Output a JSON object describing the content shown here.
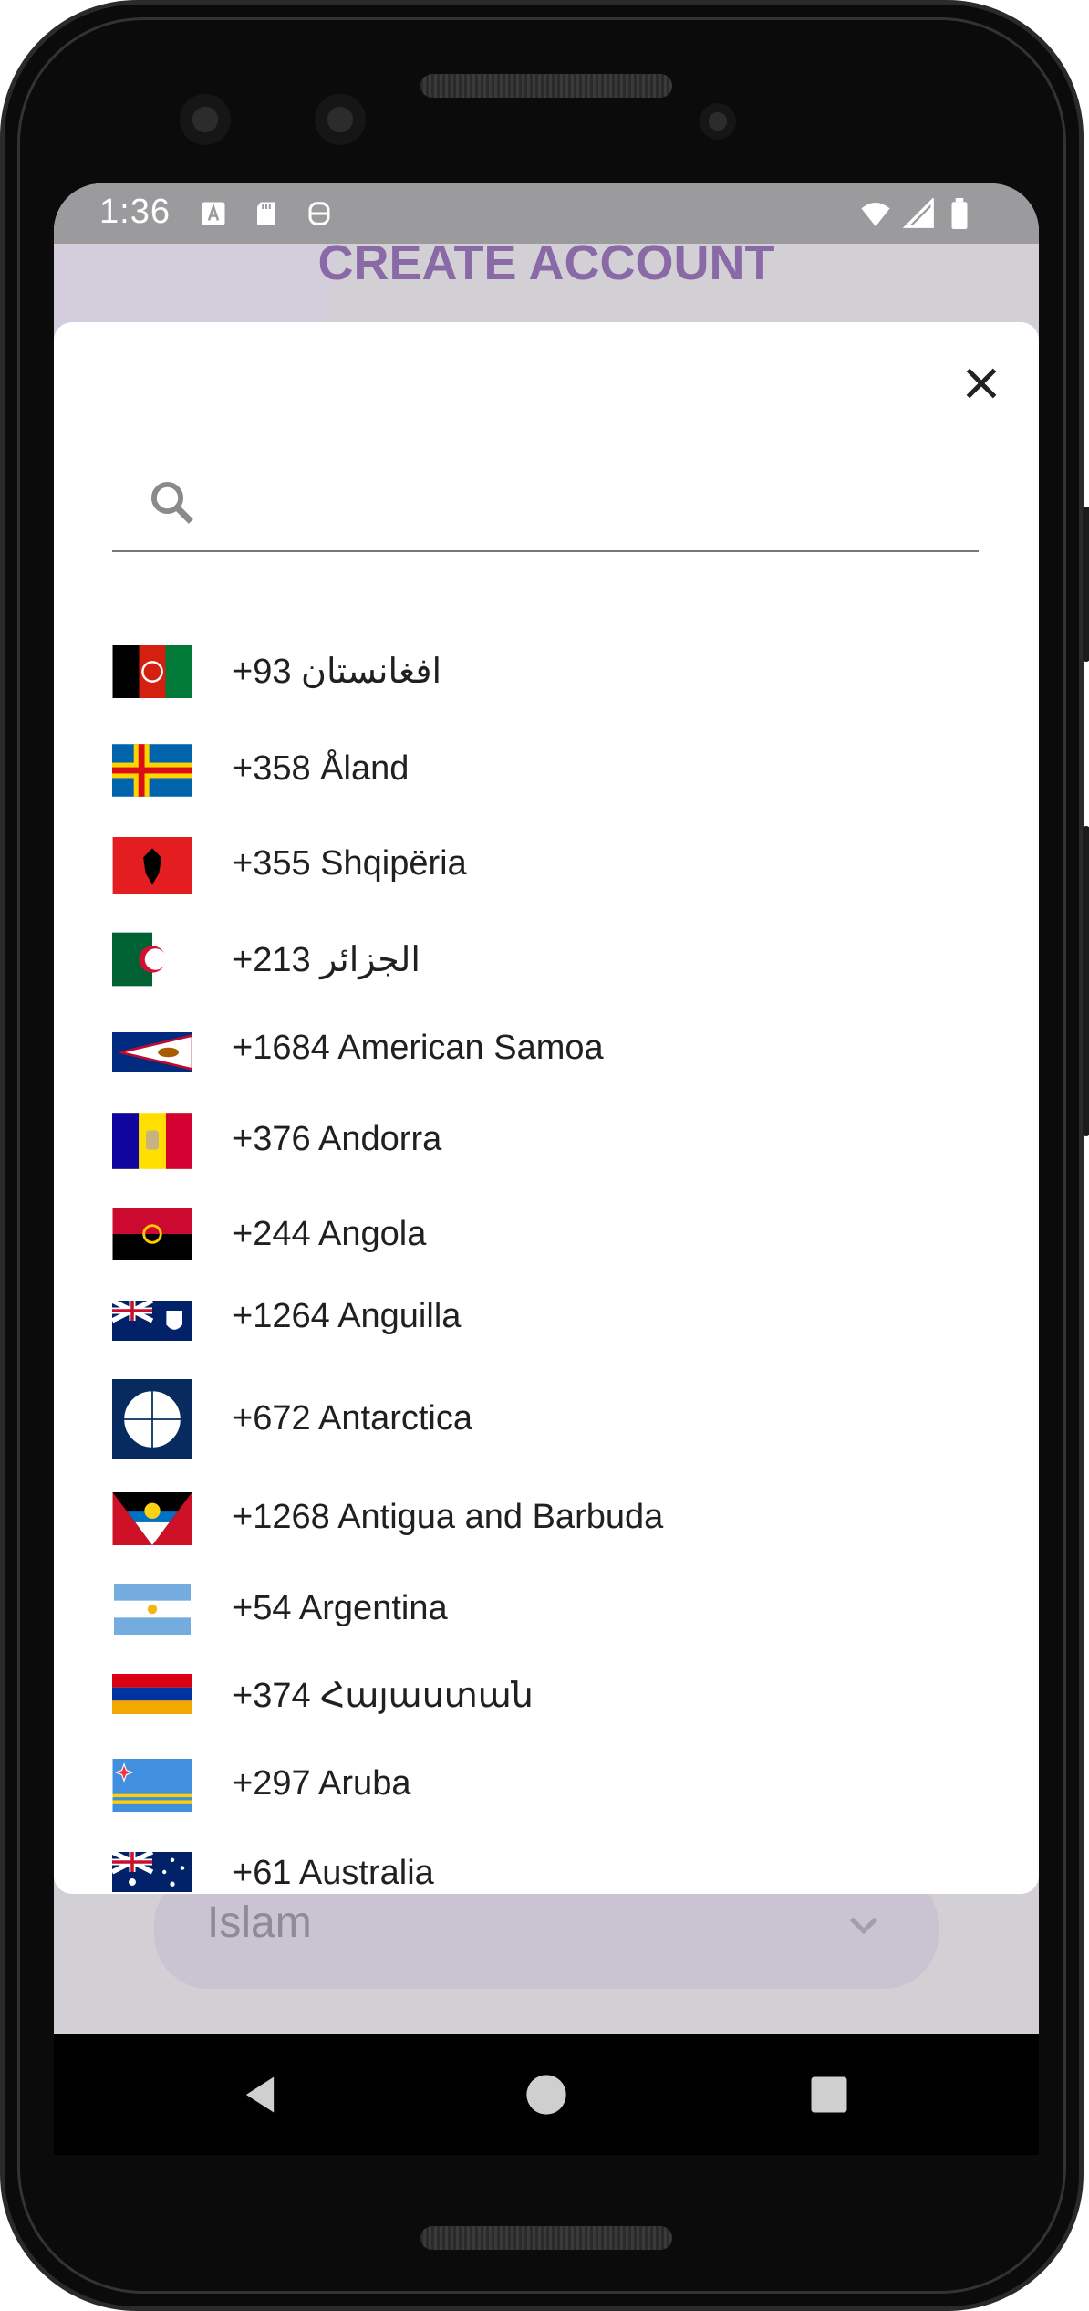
{
  "status_bar": {
    "time": "1:36"
  },
  "page": {
    "title": "CREATE ACCOUNT"
  },
  "religion_field": {
    "value": "Islam"
  },
  "country_picker": {
    "search": {
      "placeholder": "",
      "value": ""
    },
    "countries": [
      {
        "label": "+93 افغانستان",
        "flag": "afghanistan-flag"
      },
      {
        "label": "+358 Åland",
        "flag": "aland-flag"
      },
      {
        "label": "+355 Shqipëria",
        "flag": "albania-flag"
      },
      {
        "label": "+213 الجزائر",
        "flag": "algeria-flag"
      },
      {
        "label": "+1684 American Samoa",
        "flag": "american-samoa-flag"
      },
      {
        "label": "+376 Andorra",
        "flag": "andorra-flag"
      },
      {
        "label": "+244 Angola",
        "flag": "angola-flag"
      },
      {
        "label": "+1264 Anguilla",
        "flag": "anguilla-flag"
      },
      {
        "label": "+672 Antarctica",
        "flag": "antarctica-flag"
      },
      {
        "label": "+1268 Antigua and Barbuda",
        "flag": "antigua-flag"
      },
      {
        "label": "+54 Argentina",
        "flag": "argentina-flag"
      },
      {
        "label": "+374 Հայաստան",
        "flag": "armenia-flag"
      },
      {
        "label": "+297 Aruba",
        "flag": "aruba-flag"
      },
      {
        "label": "+61 Australia",
        "flag": "australia-flag"
      }
    ]
  },
  "colors": {
    "accent": "#8a6aa6",
    "statusbar": "#9b9b9e",
    "modal": "#ffffff"
  }
}
